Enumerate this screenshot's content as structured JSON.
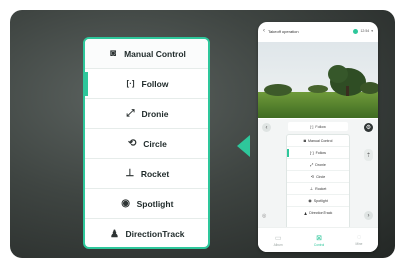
{
  "menu": {
    "items": [
      {
        "label": "Manual Control",
        "icon": "gamepad-icon",
        "glyph": "◙"
      },
      {
        "label": "Follow",
        "icon": "follow-target-icon",
        "glyph": "[·]"
      },
      {
        "label": "Dronie",
        "icon": "dronie-arrow-icon",
        "glyph": "⤢"
      },
      {
        "label": "Circle",
        "icon": "circle-orbit-icon",
        "glyph": "⟲"
      },
      {
        "label": "Rocket",
        "icon": "rocket-up-icon",
        "glyph": "⊥"
      },
      {
        "label": "Spotlight",
        "icon": "eye-icon",
        "glyph": "◉"
      },
      {
        "label": "DirectionTrack",
        "icon": "person-icon",
        "glyph": "♟"
      }
    ],
    "selected": "Follow"
  },
  "phone": {
    "header": {
      "back_glyph": "‹",
      "title": "Takeoff operation",
      "status": "12:54",
      "wifi_glyph": "▾"
    },
    "panel": {
      "current_mode": "Follow",
      "current_mode_glyph": "[·]",
      "left_chevron": "‹",
      "right_chevron": "›",
      "gear_glyph": "⚙",
      "rocket_glyph": "⇡",
      "eye_glyph": "◎"
    },
    "mini_menu": [
      {
        "label": "Manual Control",
        "glyph": "◙"
      },
      {
        "label": "Follow",
        "glyph": "[·]"
      },
      {
        "label": "Dronie",
        "glyph": "⤢"
      },
      {
        "label": "Circle",
        "glyph": "⟲"
      },
      {
        "label": "Rocket",
        "glyph": "⊥"
      },
      {
        "label": "Spotlight",
        "glyph": "◉"
      },
      {
        "label": "DirectionTrack",
        "glyph": "♟"
      }
    ],
    "nav": [
      {
        "label": "Album",
        "glyph": "▭",
        "active": false
      },
      {
        "label": "Control",
        "glyph": "⊠",
        "active": true
      },
      {
        "label": "Mine",
        "glyph": "◌",
        "active": false
      }
    ]
  },
  "colors": {
    "accent": "#2ec79b",
    "card_bg": "#3f4542",
    "menu_bg": "#ffffff"
  }
}
